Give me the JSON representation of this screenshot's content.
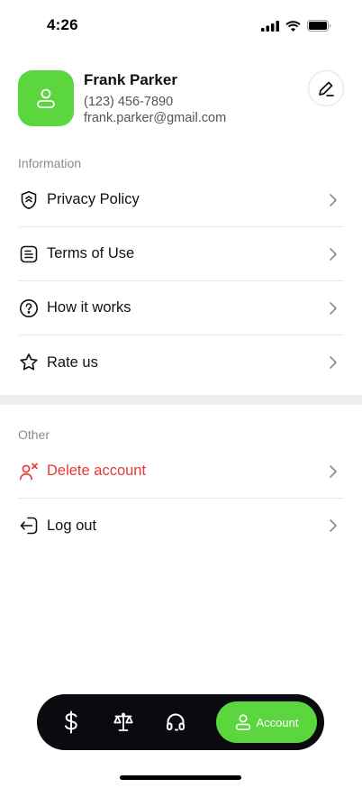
{
  "status": {
    "time": "4:26"
  },
  "profile": {
    "name": "Frank Parker",
    "phone": "(123) 456-7890",
    "email": "frank.parker@gmail.com",
    "avatar_color": "#5bd63f"
  },
  "sections": {
    "information": {
      "title": "Information",
      "items": [
        {
          "label": "Privacy Policy",
          "icon": "shield-icon"
        },
        {
          "label": "Terms of Use",
          "icon": "document-icon"
        },
        {
          "label": "How it works",
          "icon": "question-circle-icon"
        },
        {
          "label": "Rate us",
          "icon": "star-icon"
        }
      ]
    },
    "other": {
      "title": "Other",
      "items": [
        {
          "label": "Delete account",
          "icon": "user-remove-icon",
          "color": "#e53935"
        },
        {
          "label": "Log out",
          "icon": "logout-icon"
        }
      ]
    }
  },
  "tabbar": {
    "tabs": [
      {
        "icon": "dollar-icon"
      },
      {
        "icon": "scales-icon"
      },
      {
        "icon": "headset-icon"
      },
      {
        "icon": "user-icon",
        "label": "Account",
        "active": true
      }
    ],
    "active_color": "#5bd63f",
    "background": "#0b0b0f"
  }
}
